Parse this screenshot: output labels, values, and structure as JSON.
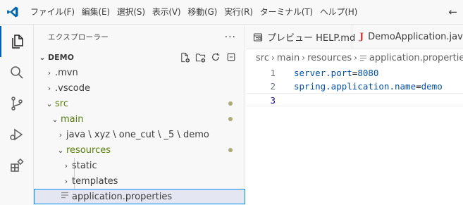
{
  "menu": {
    "items": [
      "ファイル(F)",
      "編集(E)",
      "選択(S)",
      "表示(V)",
      "移動(G)",
      "実行(R)",
      "ターミナル(T)",
      "ヘルプ(H)"
    ]
  },
  "activity": {
    "icons": [
      "explorer-icon",
      "search-icon",
      "source-control-icon",
      "run-debug-icon",
      "extensions-icon"
    ]
  },
  "sidebar": {
    "title": "エクスプローラー",
    "more": "···",
    "root": "DEMO",
    "items": [
      {
        "label": ".mvn",
        "chevron": "›"
      },
      {
        "label": ".vscode",
        "chevron": "›"
      },
      {
        "label": "src",
        "chevron": "⌄"
      },
      {
        "label": "main",
        "chevron": "⌄"
      },
      {
        "label": "java \\ xyz \\ one_cut \\ _5 \\ demo",
        "chevron": "›"
      },
      {
        "label": "resources",
        "chevron": "⌄"
      },
      {
        "label": "static",
        "chevron": "›"
      },
      {
        "label": "templates",
        "chevron": "›"
      },
      {
        "label": "application.properties",
        "chevron": ""
      }
    ]
  },
  "editor": {
    "tabs": [
      {
        "label": "プレビュー HELP.md",
        "icon": "preview-icon"
      },
      {
        "label": "DemoApplication.java",
        "icon": "java-icon",
        "icon_text": "J"
      }
    ],
    "breadcrumb": [
      "src",
      "main",
      "resources",
      "application.properties"
    ],
    "lines": [
      {
        "num": "1",
        "key": "server.port",
        "eq": "=",
        "val": "8080"
      },
      {
        "num": "2",
        "key": "spring.application.name",
        "eq": "=",
        "val": "demo"
      },
      {
        "num": "3",
        "key": "",
        "eq": "",
        "val": ""
      }
    ]
  },
  "colors": {
    "accent": "#005fb8",
    "keyword": "#0451a5",
    "java": "#cc3e44",
    "modified_dot": "#9d9e5f"
  }
}
